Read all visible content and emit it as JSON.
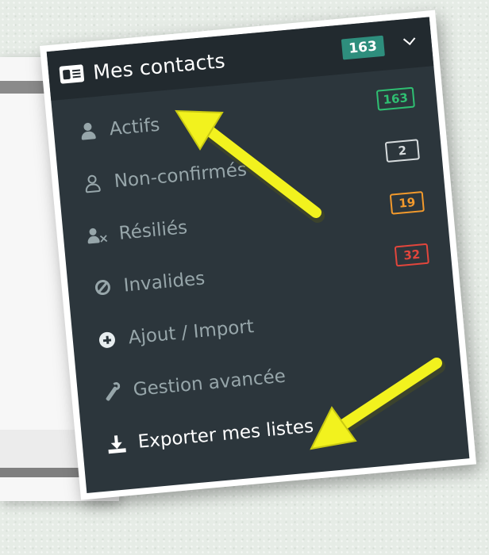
{
  "colors": {
    "panel_bg": "#2c363c",
    "header_bg": "#222a2f",
    "accent_total": "#2e8e7d",
    "badge_green": "#2fbf72",
    "badge_gray": "#d7dcde",
    "badge_orange": "#f39a2c",
    "badge_red": "#e2463c",
    "annotation_arrow": "#f2f21e"
  },
  "header": {
    "title": "Mes contacts",
    "total_count": "163",
    "icon": "contact-card-icon",
    "toggle_icon": "chevron-down-icon"
  },
  "menu": {
    "items": [
      {
        "label": "Actifs",
        "icon": "user-icon",
        "badge": "163",
        "badge_color": "#2fbf72"
      },
      {
        "label": "Non-confirmés",
        "icon": "user-outline-icon",
        "badge": "2",
        "badge_color": "#d7dcde"
      },
      {
        "label": "Résiliés",
        "icon": "user-x-icon",
        "badge": "19",
        "badge_color": "#f39a2c"
      },
      {
        "label": "Invalides",
        "icon": "ban-icon",
        "badge": "32",
        "badge_color": "#e2463c"
      },
      {
        "label": "Ajout / Import",
        "icon": "plus-circle-icon"
      },
      {
        "label": "Gestion avancée",
        "icon": "wrench-icon"
      },
      {
        "label": "Exporter mes listes",
        "icon": "download-icon",
        "active": true
      }
    ]
  }
}
